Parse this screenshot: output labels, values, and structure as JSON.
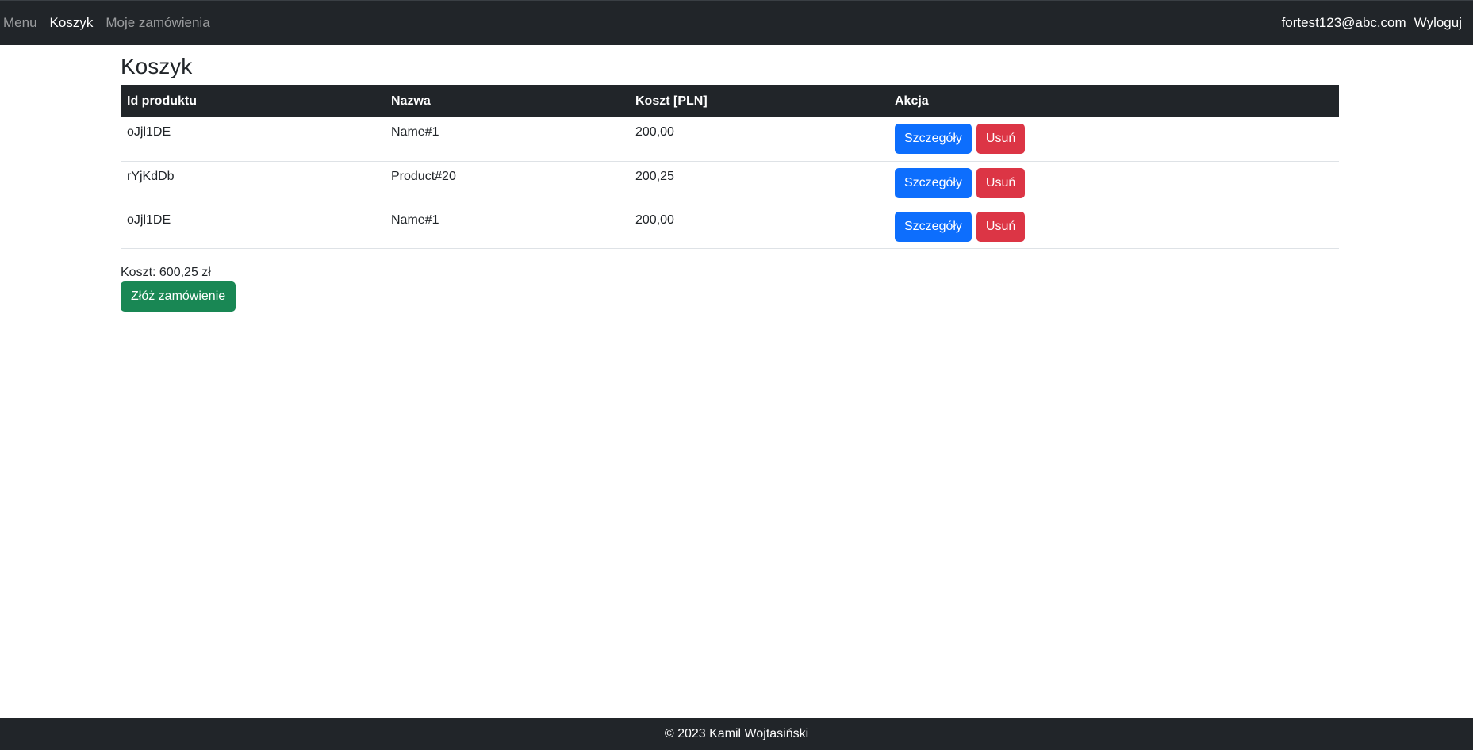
{
  "nav": {
    "links": [
      {
        "label": "Menu"
      },
      {
        "label": "Koszyk"
      },
      {
        "label": "Moje zamówienia"
      }
    ],
    "user_email": "fortest123@abc.com",
    "logout_label": "Wyloguj"
  },
  "page": {
    "title": "Koszyk"
  },
  "table": {
    "headers": [
      "Id produktu",
      "Nazwa",
      "Koszt [PLN]",
      "Akcja"
    ],
    "rows": [
      {
        "id": "oJjl1DE",
        "name": "Name#1",
        "cost": "200,00",
        "details_label": "Szczegóły",
        "remove_label": "Usuń"
      },
      {
        "id": "rYjKdDb",
        "name": "Product#20",
        "cost": "200,25",
        "details_label": "Szczegóły",
        "remove_label": "Usuń"
      },
      {
        "id": "oJjl1DE",
        "name": "Name#1",
        "cost": "200,00",
        "details_label": "Szczegóły",
        "remove_label": "Usuń"
      }
    ]
  },
  "summary": {
    "total_text": "Koszt: 600,25 zł",
    "order_button_label": "Złóż zamówienie"
  },
  "footer": {
    "text": "© 2023 Kamil Wojtasiński"
  },
  "colors": {
    "navbar": "#212529",
    "primary": "#0d6efd",
    "danger": "#dc3545",
    "success": "#198754"
  }
}
